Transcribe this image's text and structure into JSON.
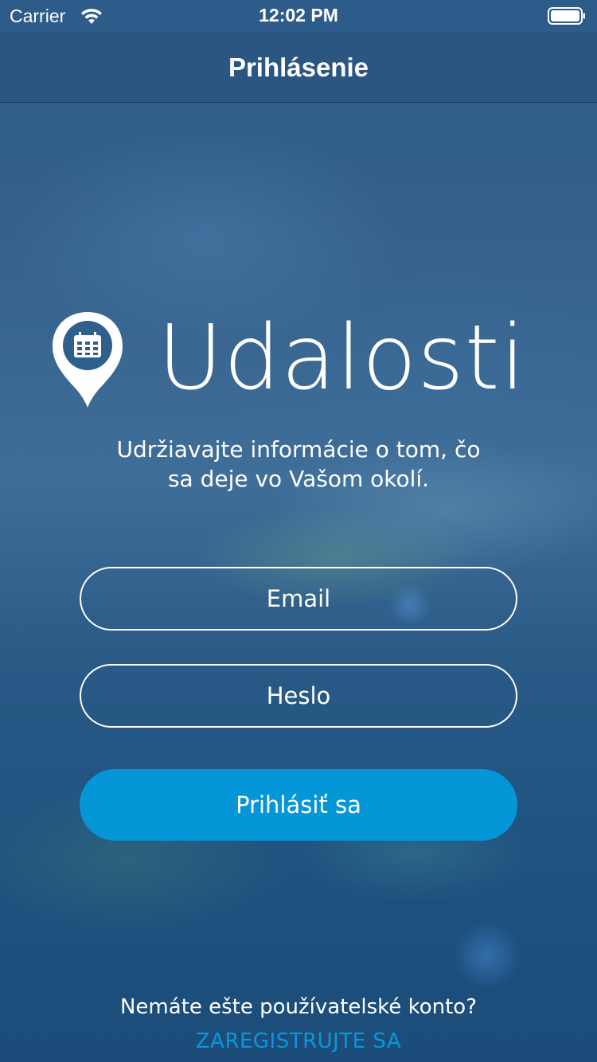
{
  "status_bar": {
    "carrier": "Carrier",
    "time": "12:02 PM",
    "wifi_icon": "wifi-icon",
    "battery_icon": "battery-icon"
  },
  "nav": {
    "title": "Prihlásenie"
  },
  "logo": {
    "app_name": "Udalosti",
    "icon": "map-pin-calendar-icon"
  },
  "tagline": {
    "line1": "Udržiavajte informácie o tom, čo",
    "line2": "sa deje vo Vašom okolí."
  },
  "form": {
    "email_placeholder": "Email",
    "password_placeholder": "Heslo",
    "login_label": "Prihlásiť sa"
  },
  "footer": {
    "no_account_text": "Nemáte ešte používatelské konto?",
    "register_label": "ZAREGISTRUJTE SA"
  },
  "colors": {
    "accent": "#0596d8",
    "link": "#0b97d8",
    "text": "#ffffff"
  }
}
